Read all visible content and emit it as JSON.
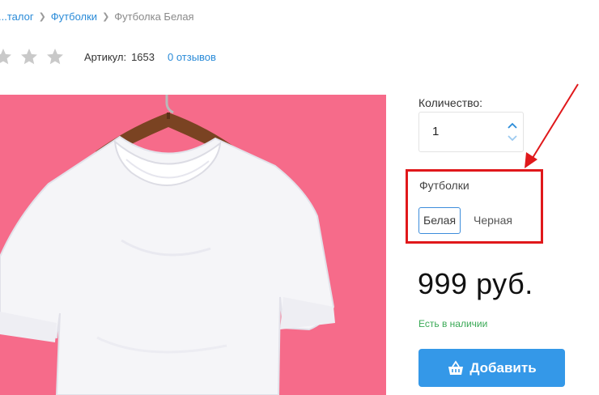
{
  "breadcrumb": {
    "items": [
      "...талог",
      "Футболки"
    ],
    "current": "Футболка Белая"
  },
  "rating": {
    "stars_filled": 0,
    "stars_total": 5,
    "sku_label": "Артикул:",
    "sku_value": "1653",
    "reviews_link": "0 отзывов"
  },
  "quantity": {
    "label": "Количество:",
    "value": "1"
  },
  "variant": {
    "title": "Футболки",
    "options": [
      "Белая",
      "Черная"
    ],
    "selected": "Белая"
  },
  "price": "999 руб.",
  "stock_status": "Есть в наличии",
  "add_button_label": "Добавить",
  "colors": {
    "accent": "#3498e8",
    "link": "#2a8bd8",
    "image_background": "#f66b8a",
    "highlight": "#e0181b",
    "in_stock": "#3aa956"
  }
}
